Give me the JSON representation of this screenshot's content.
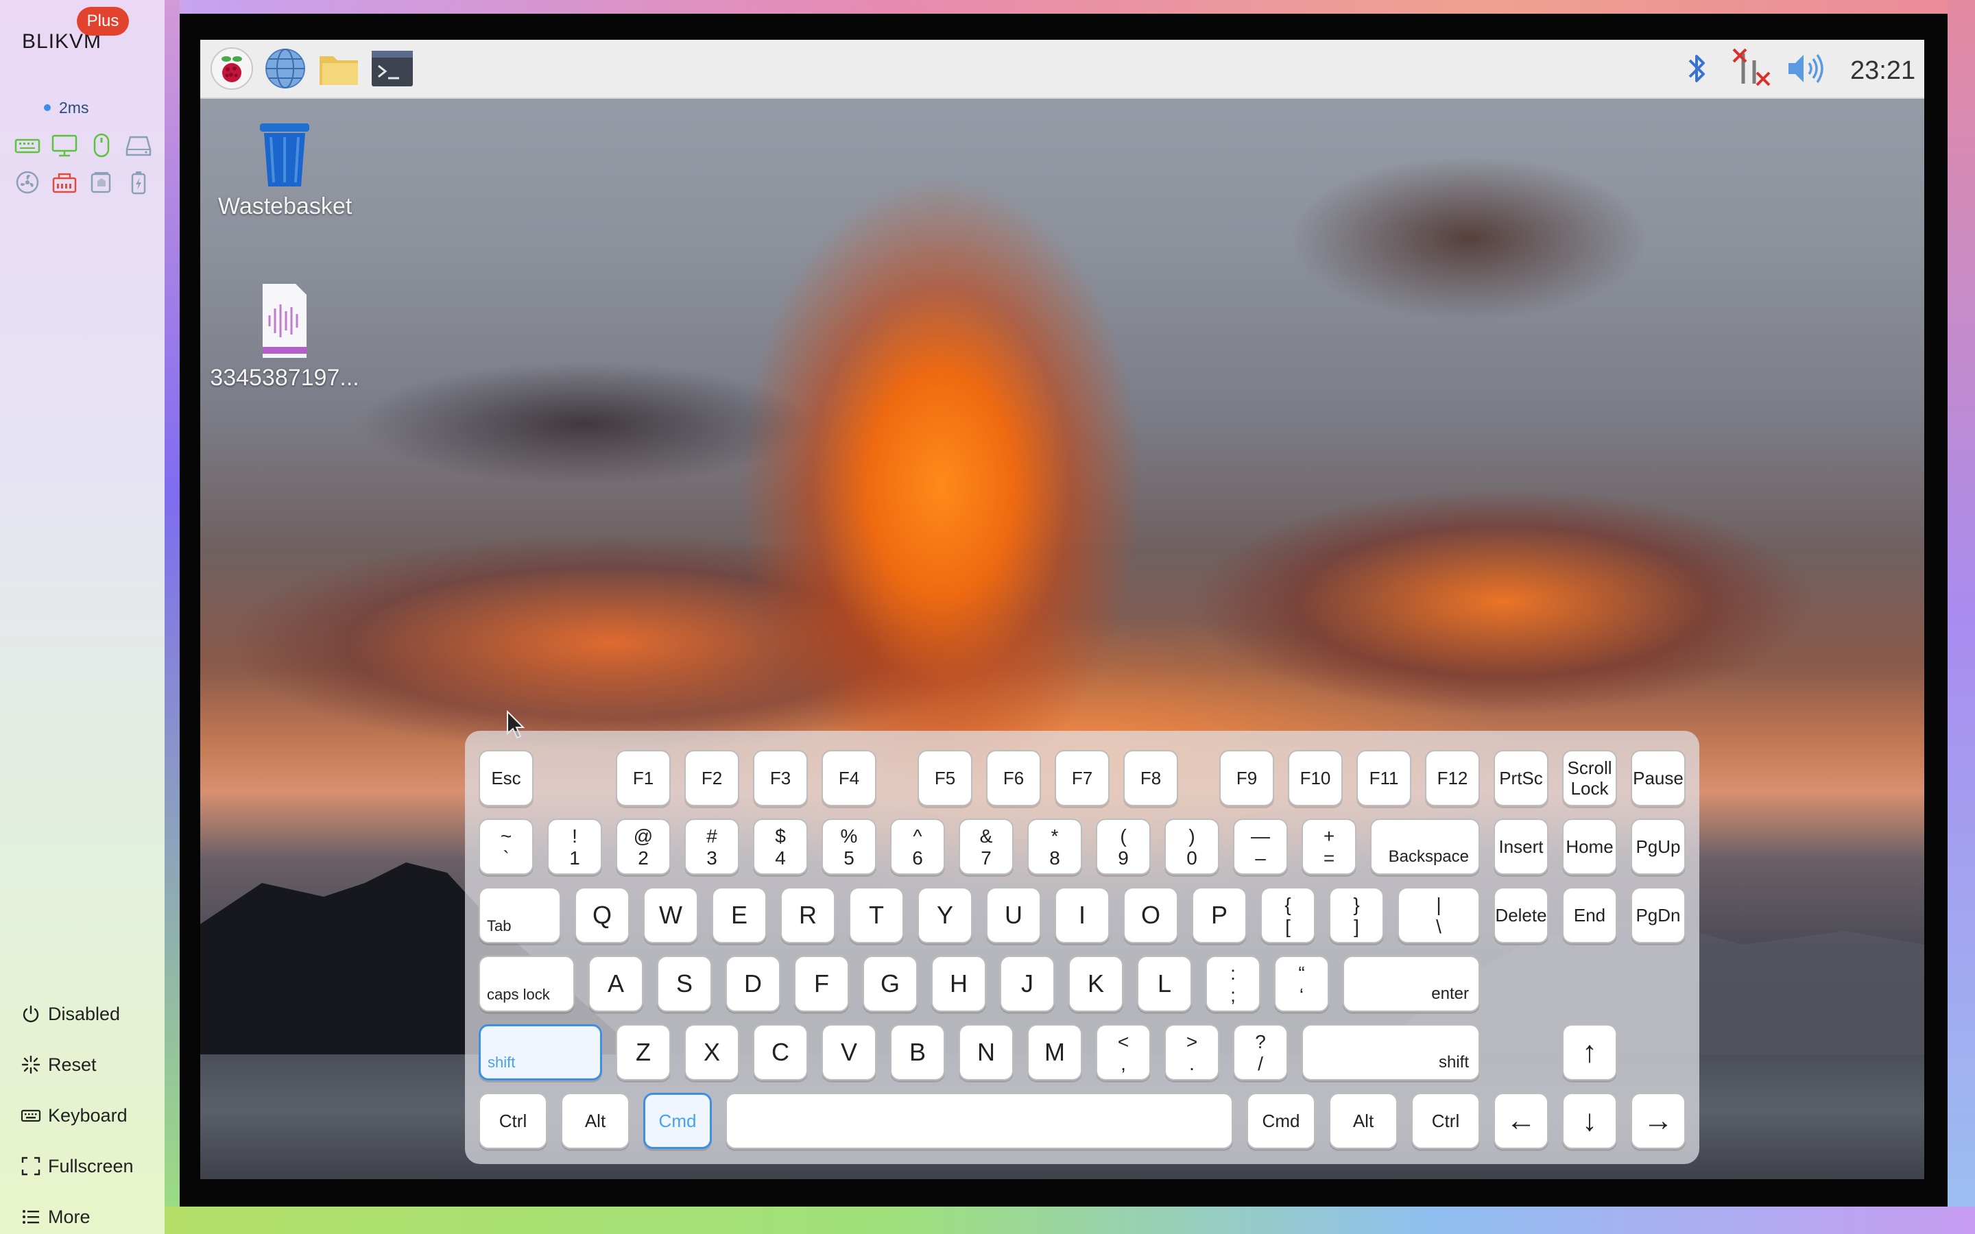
{
  "sidebar": {
    "brand": "BLIKVM",
    "badge": "Plus",
    "latency": "2ms",
    "status_icons": [
      [
        "keyboard-status-icon",
        "monitor-status-icon",
        "mouse-status-icon",
        "drive-status-icon"
      ],
      [
        "fan-status-icon",
        "network-status-icon",
        "power-status-icon",
        "battery-status-icon"
      ]
    ],
    "menu": [
      {
        "label": "Disabled",
        "icon": "power-icon"
      },
      {
        "label": "Reset",
        "icon": "reset-icon"
      },
      {
        "label": "Keyboard",
        "icon": "keyboard-icon"
      },
      {
        "label": "Fullscreen",
        "icon": "fullscreen-icon"
      },
      {
        "label": "More",
        "icon": "more-icon"
      }
    ]
  },
  "remote": {
    "taskbar": {
      "left_icons": [
        "raspberry-menu-icon",
        "browser-icon",
        "file-manager-icon",
        "terminal-icon"
      ],
      "right_icons": [
        "bluetooth-icon",
        "network-disconnected-icon",
        "volume-icon"
      ],
      "clock": "23:21"
    },
    "desktop_icons": [
      {
        "label": "Wastebasket",
        "icon": "wastebasket-icon"
      },
      {
        "label": "3345387197...",
        "icon": "audio-file-icon"
      }
    ]
  },
  "colors": {
    "accent": "#3d8fe6",
    "badge": "#e2432f",
    "status_green": "#5cc33c",
    "status_red": "#e24a3a",
    "status_gray": "#8aa0b8"
  },
  "keyboard": {
    "row1": [
      "Esc",
      "F1",
      "F2",
      "F3",
      "F4",
      "F5",
      "F6",
      "F7",
      "F8",
      "F9",
      "F10",
      "F11",
      "F12",
      "PrtSc",
      [
        "Scroll",
        "Lock"
      ],
      "Pause"
    ],
    "row2": [
      [
        "~",
        "`"
      ],
      [
        "!",
        "1"
      ],
      [
        "@",
        "2"
      ],
      [
        "#",
        "3"
      ],
      [
        "$",
        "4"
      ],
      [
        "%",
        "5"
      ],
      [
        "^",
        "6"
      ],
      [
        "&",
        "7"
      ],
      [
        "*",
        "8"
      ],
      [
        "(",
        "9"
      ],
      [
        ")",
        "0"
      ],
      [
        "—",
        "–"
      ],
      [
        "+",
        "="
      ],
      "Backspace",
      "Insert",
      "Home",
      "PgUp"
    ],
    "row3": [
      "Tab",
      "Q",
      "W",
      "E",
      "R",
      "T",
      "Y",
      "U",
      "I",
      "O",
      "P",
      [
        "{",
        "["
      ],
      [
        "}",
        "]"
      ],
      [
        "|",
        "\\"
      ],
      "Delete",
      "End",
      "PgDn"
    ],
    "row4": [
      "caps lock",
      "A",
      "S",
      "D",
      "F",
      "G",
      "H",
      "J",
      "K",
      "L",
      [
        ":",
        ";"
      ],
      [
        "“",
        "‘"
      ],
      "enter"
    ],
    "row5": [
      "shift",
      "Z",
      "X",
      "C",
      "V",
      "B",
      "N",
      "M",
      [
        "<",
        ","
      ],
      [
        ">",
        "."
      ],
      [
        "?",
        "/"
      ],
      "shift",
      "↑"
    ],
    "row6": [
      "Ctrl",
      "Alt",
      "Cmd",
      "",
      "Cmd",
      "Alt",
      "Ctrl",
      "←",
      "↓",
      "→"
    ],
    "active_keys": [
      "Shift (left)",
      "Cmd (left)"
    ]
  }
}
